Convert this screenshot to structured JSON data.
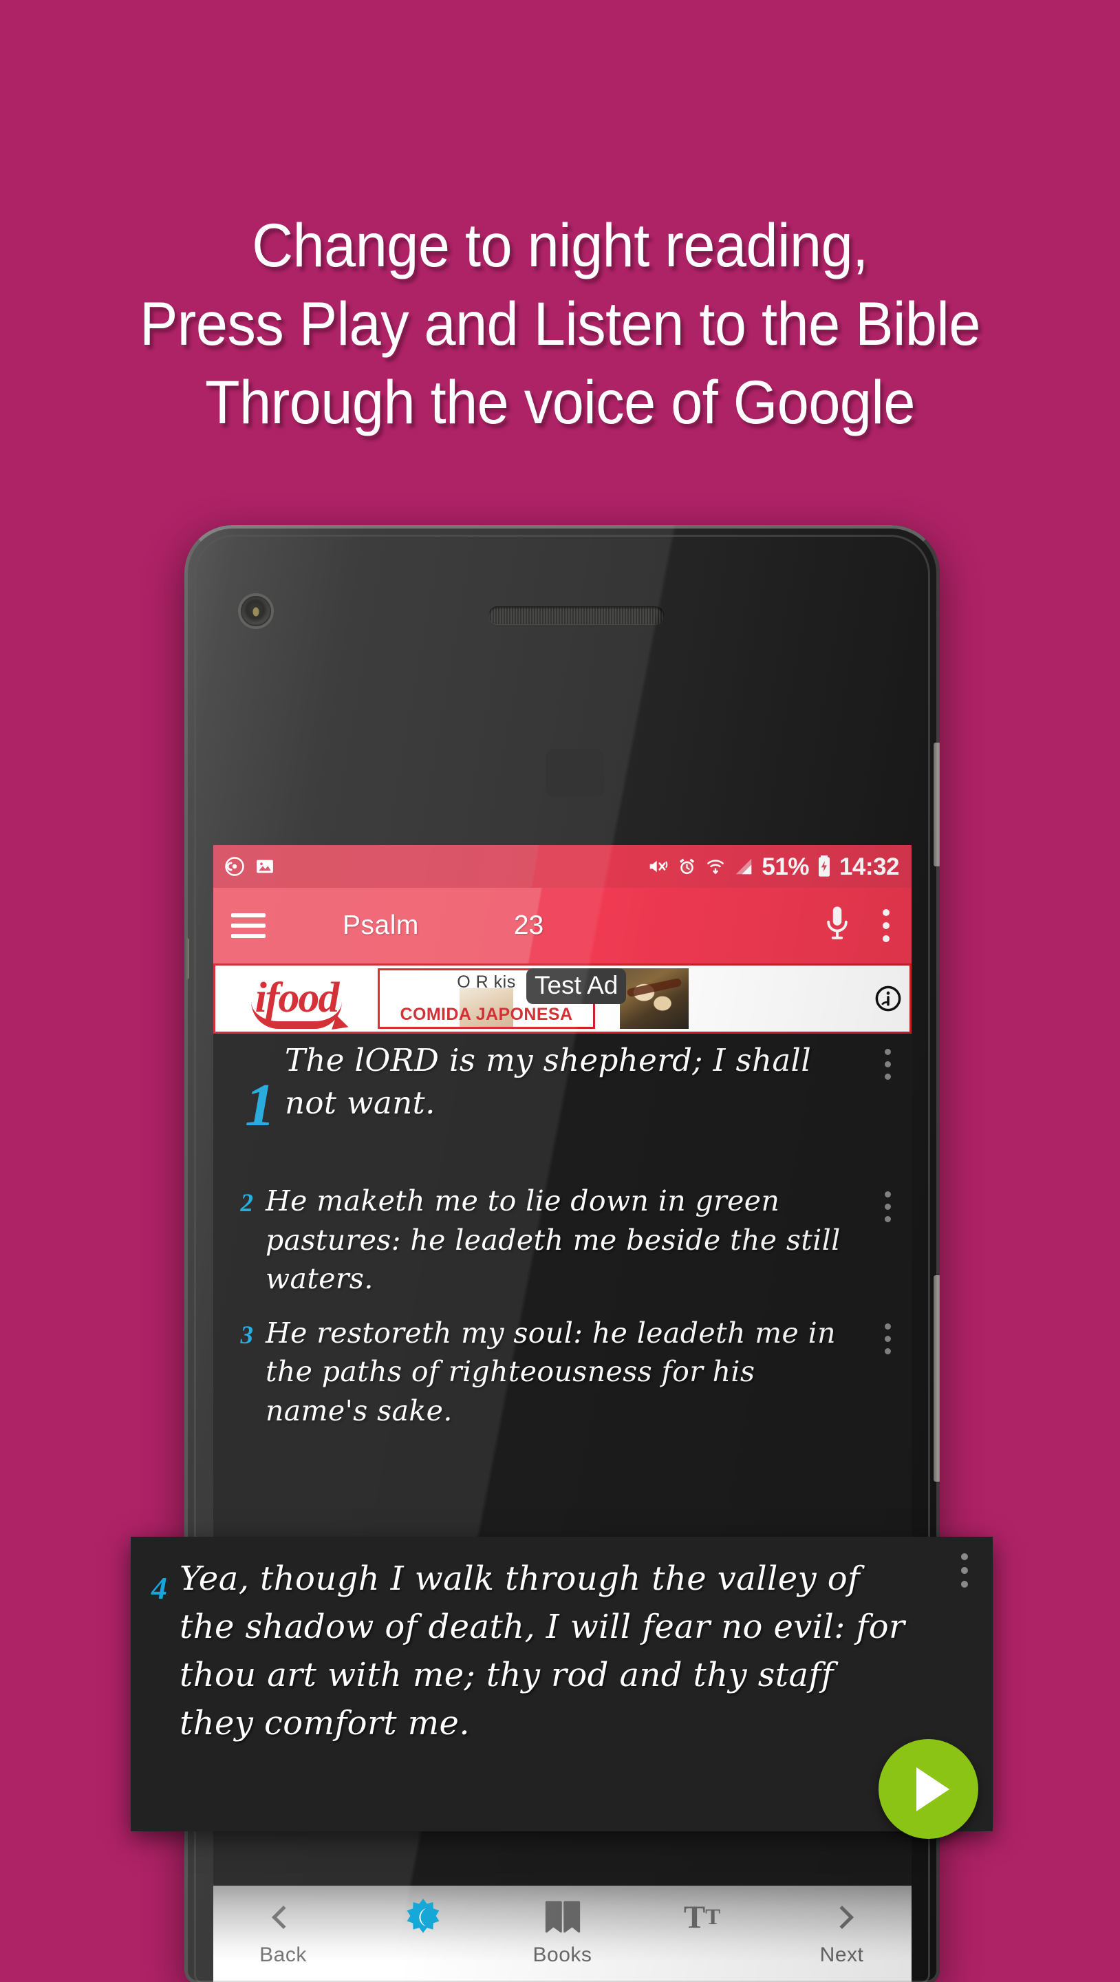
{
  "promo": {
    "background_color": "#AE2266",
    "headline_lines": [
      "Change to night reading,",
      "Press Play and Listen to the Bible",
      "Through the voice of Google"
    ]
  },
  "device": {
    "status_bar": {
      "left_icons": [
        "cast-icon",
        "screenshot-image-icon"
      ],
      "right_icons": [
        "mute-vibrate-icon",
        "alarm-icon",
        "wifi-icon",
        "cellular-signal-icon",
        "battery-charging-icon"
      ],
      "battery_percent": "51%",
      "time": "14:32"
    }
  },
  "toolbar": {
    "menu_icon": "hamburger-menu-icon",
    "book_title": "Psalm",
    "chapter_number": "23",
    "mic_icon": "microphone-icon",
    "overflow_icon": "kebab-menu-icon"
  },
  "ad": {
    "advertiser": "ifood",
    "badge_label": "Test Ad",
    "headline": "O R          kis",
    "subtitle": "COMIDA JAPONESA",
    "info_icon": "ad-info-icon",
    "brand_color": "#CF2026"
  },
  "reader": {
    "accent_color": "#18A5DC",
    "background_color": "#1C1C1C",
    "verses": [
      {
        "number": "1",
        "text": "The lORD is my shepherd; I shall not want."
      },
      {
        "number": "2",
        "text": "He maketh me to lie down in green pastures: he leadeth me beside the still waters."
      },
      {
        "number": "3",
        "text": "He restoreth my soul: he leadeth me in the paths of righteousness for his name's sake."
      }
    ],
    "highlighted_verse": {
      "number": "4",
      "text": "Yea, though I walk through the valley of the shadow of death, I will fear no evil: for thou art with me; thy rod and thy staff they comfort me."
    }
  },
  "play_button": {
    "icon": "play-icon",
    "color": "#8CC415"
  },
  "bottom_nav": {
    "items": [
      {
        "label": "Back",
        "icon": "chevron-left-icon"
      },
      {
        "label": "",
        "icon": "night-mode-icon"
      },
      {
        "label": "Books",
        "icon": "open-book-icon"
      },
      {
        "label": "",
        "icon": "text-size-icon"
      },
      {
        "label": "Next",
        "icon": "chevron-right-icon"
      }
    ]
  }
}
